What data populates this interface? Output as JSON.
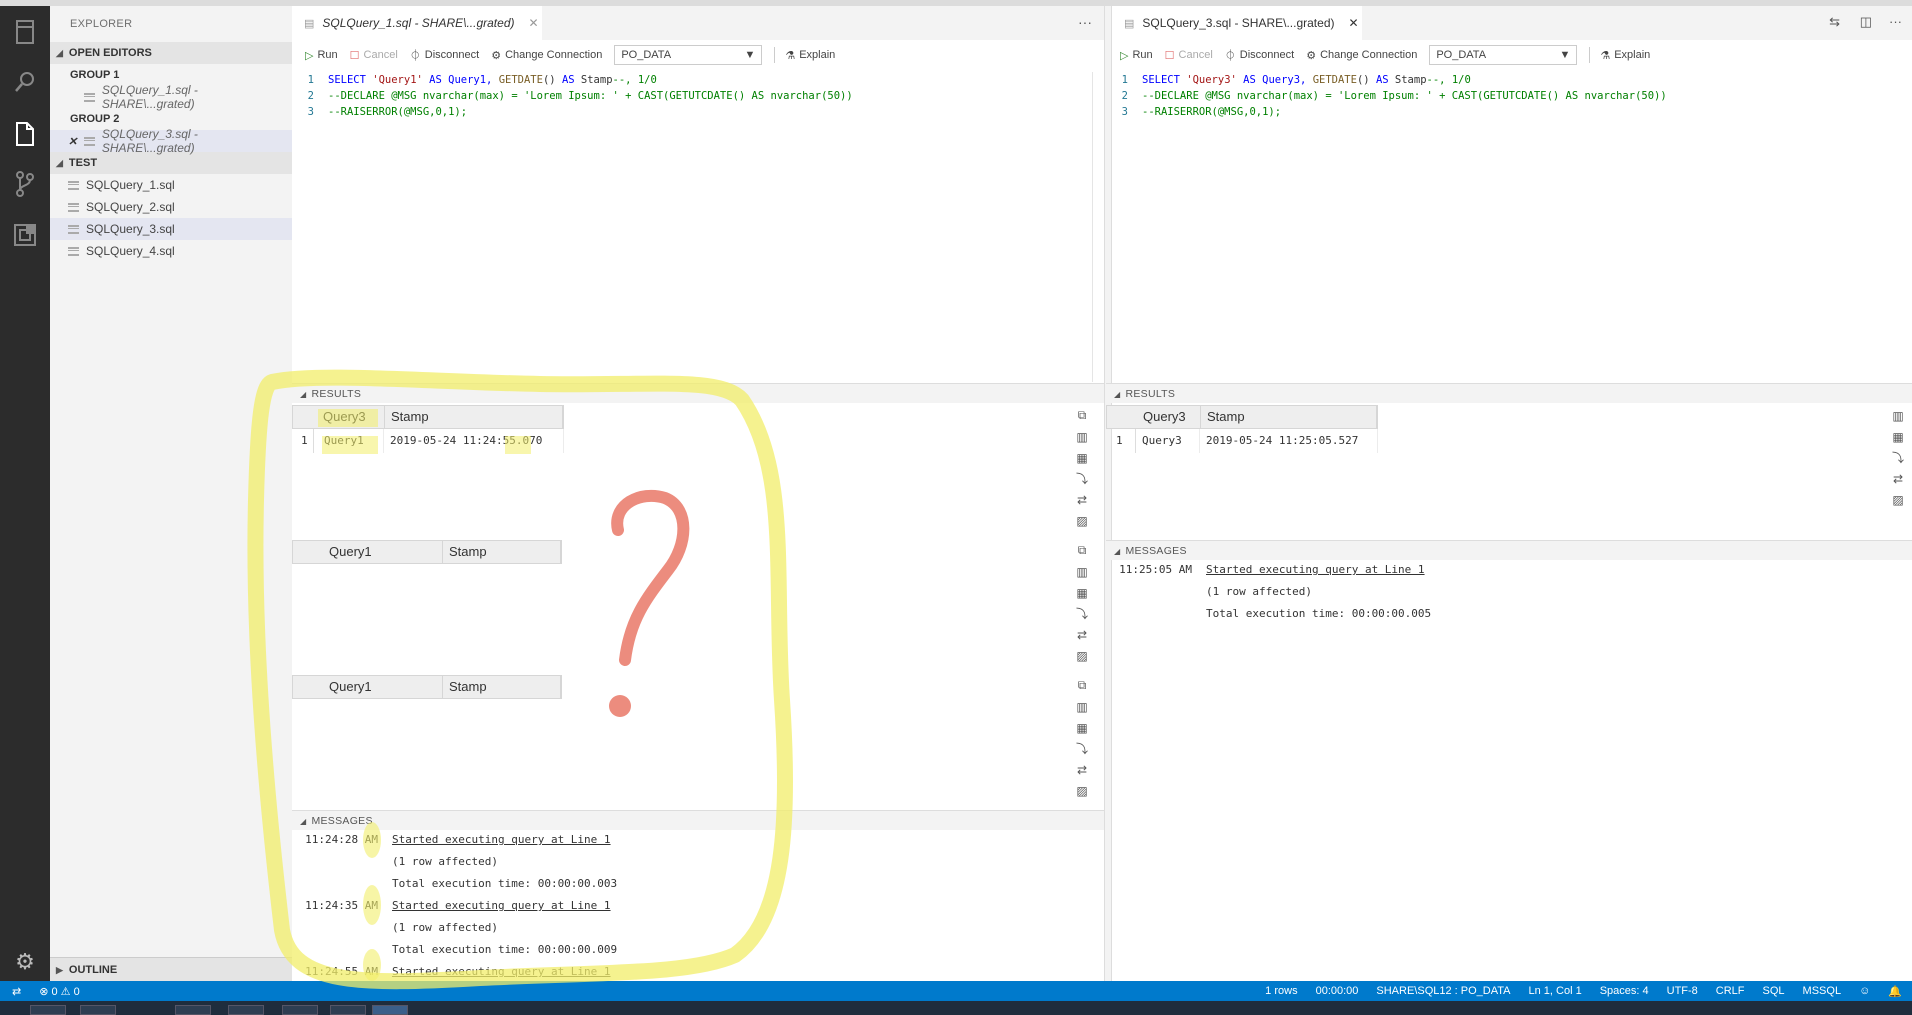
{
  "sidebar": {
    "title": "EXPLORER",
    "open_editors": {
      "header": "OPEN EDITORS",
      "groups": [
        {
          "label": "GROUP 1",
          "file": "SQLQuery_1.sql - SHARE\\...grated)"
        },
        {
          "label": "GROUP 2",
          "file": "SQLQuery_3.sql - SHARE\\...grated)"
        }
      ]
    },
    "folder": {
      "header": "TEST",
      "files": [
        "SQLQuery_1.sql",
        "SQLQuery_2.sql",
        "SQLQuery_3.sql",
        "SQLQuery_4.sql"
      ]
    },
    "outline": "OUTLINE"
  },
  "icons": {
    "activity": [
      "files-icon",
      "search-icon",
      "document-icon",
      "source-control-icon",
      "extensions-icon",
      "gear-icon"
    ]
  },
  "editor_left": {
    "tab_title": "SQLQuery_1.sql - SHARE\\...grated)",
    "toolbar": {
      "run": "Run",
      "cancel": "Cancel",
      "disconnect": "Disconnect",
      "change_connection": "Change Connection",
      "database": "PO_DATA",
      "explain": "Explain"
    },
    "code": {
      "line1": {
        "num": "1",
        "p1": "SELECT",
        "p2": " ",
        "p3": "'Query1'",
        "p4": " AS Query1, ",
        "p5": "GETDATE",
        "p6": "() ",
        "p7": "AS",
        "p8": " Stamp",
        "p9": "--, 1/0"
      },
      "line2": {
        "num": "2",
        "text": "--DECLARE @MSG nvarchar(max) = 'Lorem Ipsum: ' +  CAST(GETUTCDATE() AS nvarchar(50))"
      },
      "line3": {
        "num": "3",
        "text": "--RAISERROR(@MSG,0,1);"
      }
    },
    "results": {
      "header": "RESULTS",
      "grid1": {
        "columns": [
          "Query3",
          "Stamp"
        ],
        "rows": [
          {
            "num": "1",
            "c1": "Query1",
            "c2": "2019-05-24 11:24:55.070"
          }
        ]
      },
      "grid2": {
        "columns": [
          "Query1",
          "Stamp"
        ]
      },
      "grid3": {
        "columns": [
          "Query1",
          "Stamp"
        ]
      }
    },
    "messages": {
      "header": "MESSAGES",
      "entries": [
        {
          "time": "11:24:28 AM",
          "link": "Started executing query at Line 1",
          "l2": "(1 row affected)",
          "l3": "Total execution time: 00:00:00.003"
        },
        {
          "time": "11:24:35 AM",
          "link": "Started executing query at Line 1",
          "l2": "(1 row affected)",
          "l3": "Total execution time: 00:00:00.009"
        },
        {
          "time": "11:24:55 AM",
          "link": "Started executing query at Line 1"
        }
      ]
    }
  },
  "editor_right": {
    "tab_title": "SQLQuery_3.sql - SHARE\\...grated)",
    "toolbar": {
      "run": "Run",
      "cancel": "Cancel",
      "disconnect": "Disconnect",
      "change_connection": "Change Connection",
      "database": "PO_DATA",
      "explain": "Explain"
    },
    "code": {
      "line1": {
        "num": "1",
        "p1": "SELECT",
        "p2": " ",
        "p3": "'Query3'",
        "p4": " AS Query3, ",
        "p5": "GETDATE",
        "p6": "() ",
        "p7": "AS",
        "p8": " Stamp",
        "p9": "--, 1/0"
      },
      "line2": {
        "num": "2",
        "text": "--DECLARE @MSG nvarchar(max) = 'Lorem Ipsum: ' +  CAST(GETUTCDATE() AS nvarchar(50))"
      },
      "line3": {
        "num": "3",
        "text": "--RAISERROR(@MSG,0,1);"
      }
    },
    "results": {
      "header": "RESULTS",
      "grid1": {
        "columns": [
          "Query3",
          "Stamp"
        ],
        "rows": [
          {
            "num": "1",
            "c1": "Query3",
            "c2": "2019-05-24 11:25:05.527"
          }
        ]
      }
    },
    "messages": {
      "header": "MESSAGES",
      "entries": [
        {
          "time": "11:25:05 AM",
          "link": "Started executing query at Line 1",
          "l2": "(1 row affected)",
          "l3": "Total execution time: 00:00:00.005"
        }
      ]
    }
  },
  "statusbar": {
    "errors": "0",
    "warnings": "0",
    "rows": "1 rows",
    "elapsed": "00:00:00",
    "connection": "SHARE\\SQL12 : PO_DATA",
    "position": "Ln 1, Col 1",
    "spaces": "Spaces: 4",
    "encoding": "UTF-8",
    "eol": "CRLF",
    "language": "SQL",
    "provider": "MSSQL"
  },
  "annotation": {
    "question_mark": "?",
    "highlight_color": "#f2ee6a",
    "mark_color": "#ec8c7e"
  },
  "colors": {
    "accent": "#007acc",
    "activity_bg": "#2c2c2c",
    "sidebar_bg": "#f3f3f3"
  }
}
